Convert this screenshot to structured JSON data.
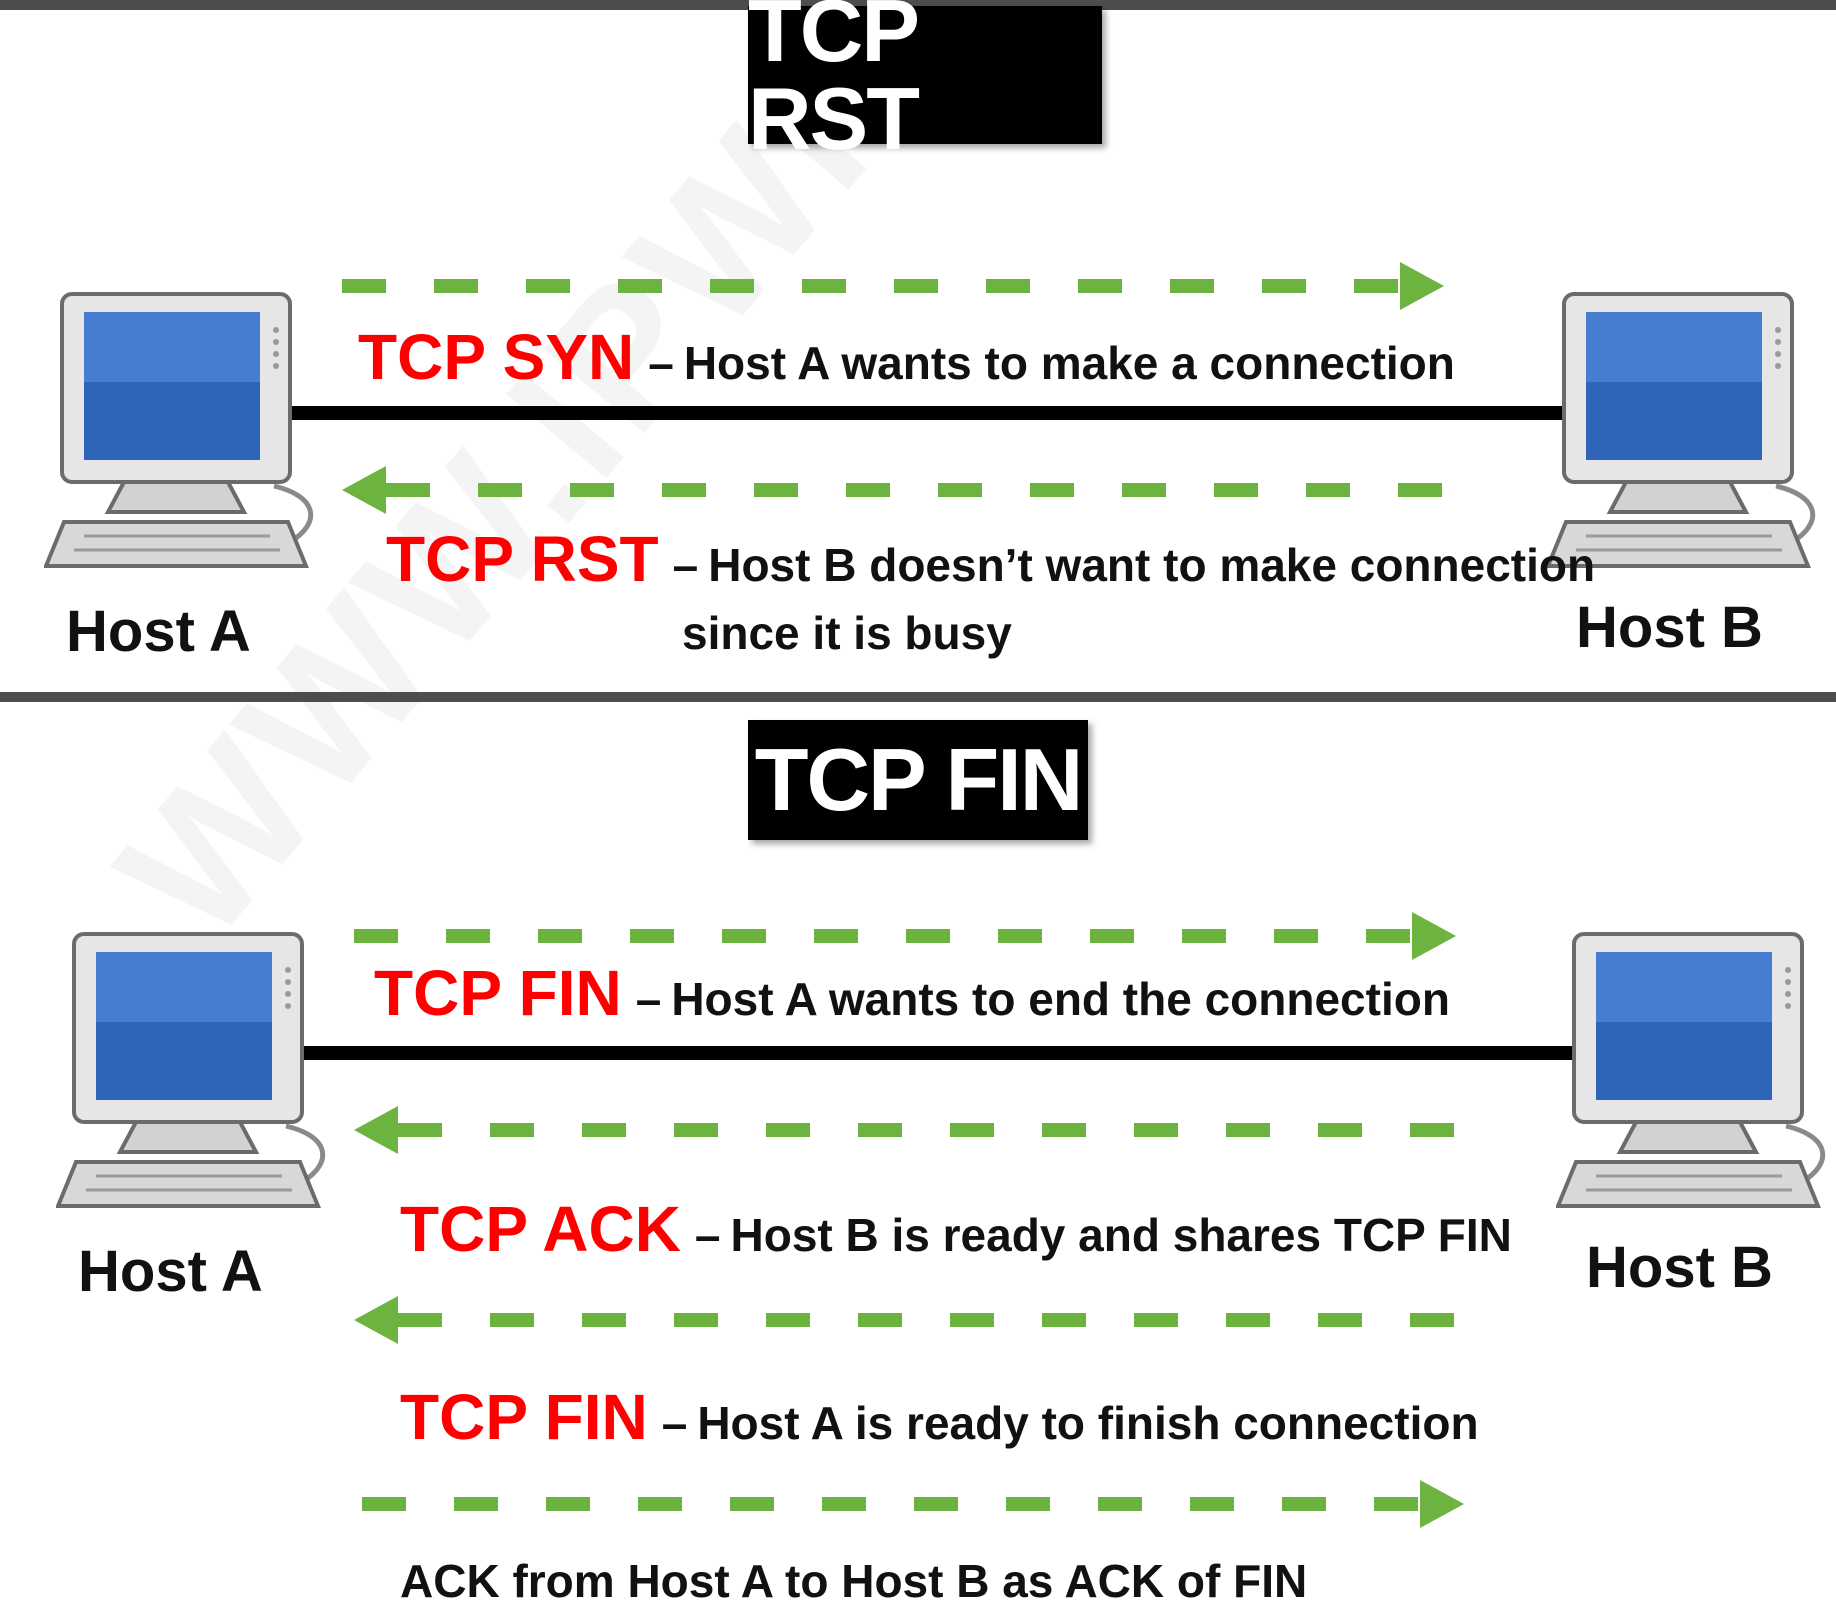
{
  "watermark": "WWW.IPWITHEASE.COM",
  "colors": {
    "accent_red": "#ff0000",
    "arrow_green": "#6db33f",
    "title_bg": "#000000"
  },
  "rst": {
    "title": "TCP RST",
    "host_a": "Host A",
    "host_b": "Host B",
    "msg1": {
      "key": "TCP SYN",
      "sep": "–",
      "text": "Host A wants to make a connection",
      "direction": "A-to-B"
    },
    "msg2": {
      "key": "TCP RST",
      "sep": "–",
      "text": "Host B doesn’t want to make connection",
      "text2": "since it is busy",
      "direction": "B-to-A"
    }
  },
  "fin": {
    "title": "TCP FIN",
    "host_a": "Host A",
    "host_b": "Host B",
    "msg1": {
      "key": "TCP FIN",
      "sep": "–",
      "text": "Host A wants to end the connection",
      "direction": "A-to-B"
    },
    "msg2": {
      "key": "TCP ACK",
      "sep": "–",
      "text": "Host B is ready and shares TCP FIN",
      "direction": "B-to-A"
    },
    "msg3": {
      "key": "TCP FIN",
      "sep": "–",
      "text": "Host A is ready to finish connection",
      "direction": "B-to-A"
    },
    "msg4": {
      "text": "ACK from Host A to Host B as ACK of FIN",
      "direction": "A-to-B"
    }
  }
}
